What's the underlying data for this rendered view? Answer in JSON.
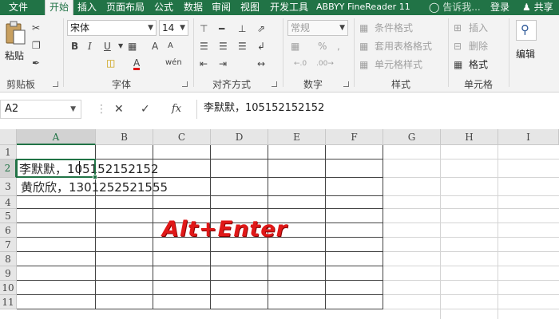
{
  "colors": {
    "accent": "#217346",
    "overlay": "#e01818"
  },
  "tabs": [
    {
      "id": "file",
      "label": "文件",
      "active": false
    },
    {
      "id": "home",
      "label": "开始",
      "active": true
    },
    {
      "id": "insert",
      "label": "插入",
      "active": false
    },
    {
      "id": "layout",
      "label": "页面布局",
      "active": false
    },
    {
      "id": "formulas",
      "label": "公式",
      "active": false
    },
    {
      "id": "data",
      "label": "数据",
      "active": false
    },
    {
      "id": "review",
      "label": "审阅",
      "active": false
    },
    {
      "id": "view",
      "label": "视图",
      "active": false
    },
    {
      "id": "developer",
      "label": "开发工具",
      "active": false
    },
    {
      "id": "abbyy",
      "label": "ABBYY FineReader 11",
      "active": false
    }
  ],
  "tell_me": {
    "icon": "lightbulb-icon",
    "placeholder": "告诉我..."
  },
  "sign_in": "登录",
  "share": {
    "icon": "person-icon",
    "label": "共享"
  },
  "ribbon": {
    "clipboard": {
      "label": "剪贴板",
      "paste": "粘贴"
    },
    "font": {
      "label": "字体",
      "font_name": "宋体",
      "font_size": "14",
      "bold": "B",
      "italic": "I",
      "underline": "U",
      "grow": "A",
      "shrink": "A",
      "font_color": "A",
      "phonetic": "wén"
    },
    "alignment": {
      "label": "对齐方式"
    },
    "number": {
      "label": "数字",
      "format": "常规"
    },
    "styles": {
      "label": "样式",
      "conditional": "条件格式",
      "table": "套用表格格式",
      "cell_styles": "单元格样式"
    },
    "cells": {
      "label": "单元格",
      "insert": "插入",
      "delete": "删除",
      "format": "格式"
    },
    "editing": {
      "label": "编辑"
    }
  },
  "formula_bar": {
    "name_box": "A2",
    "content": "李默默，105152152152"
  },
  "grid": {
    "columns": [
      "A",
      "B",
      "C",
      "D",
      "E",
      "F",
      "G",
      "H",
      "I"
    ],
    "rows": [
      "1",
      "2",
      "3",
      "4",
      "5",
      "6",
      "7",
      "8",
      "9",
      "10",
      "11"
    ],
    "cells": {
      "A2": "李默默，105152152152",
      "A3": "黄欣欣，1301252521555"
    }
  },
  "overlay_text": "Alt+Enter"
}
